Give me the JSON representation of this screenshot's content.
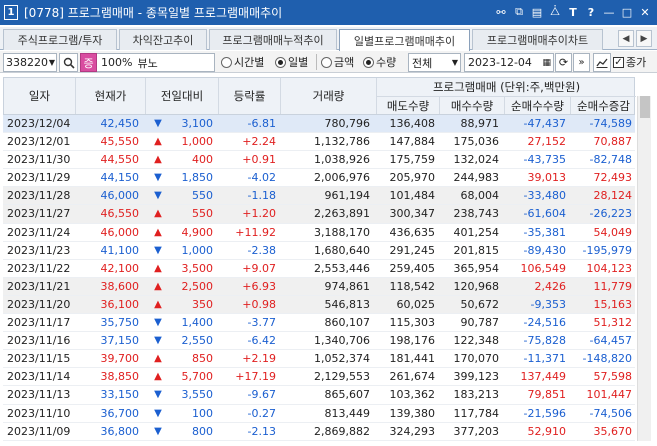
{
  "window": {
    "number": "1",
    "title": "[0778] 프로그램매매 - 종목일별 프로그램매매추이",
    "icons": [
      "link-icon",
      "copy-icon",
      "window-icon",
      "pin-icon",
      "text-icon",
      "help-icon",
      "minimize-icon",
      "maximize-icon",
      "close-icon"
    ]
  },
  "tabs": [
    {
      "label": "주식프로그램/투자"
    },
    {
      "label": "차익잔고추이"
    },
    {
      "label": "프로그램매매누적추이"
    },
    {
      "label": "일별프로그램매매추이",
      "active": true
    },
    {
      "label": "프로그램매매추이차트"
    }
  ],
  "toolbar": {
    "code": "338220",
    "badge": "증",
    "ratio": "100%",
    "stock_name": "뷰노",
    "radio_time": "시간별",
    "radio_daily": "일별",
    "radio_amount": "금액",
    "radio_qty": "수량",
    "market_select": "전체",
    "date": "2023-12-04",
    "checkbox_label": "종가"
  },
  "header": {
    "date": "일자",
    "price": "현재가",
    "change": "전일대비",
    "rate": "등락률",
    "volume": "거래량",
    "program_group": "프로그램매매 (단위:주,백만원)",
    "sell": "매도수량",
    "buy": "매수수량",
    "net": "순매수수량",
    "net_change": "순매수증감"
  },
  "rows": [
    {
      "date": "2023/12/04",
      "price": "42,450",
      "dir": "dn",
      "change": "3,100",
      "rate": "-6.81",
      "volume": "780,796",
      "sell": "136,408",
      "buy": "88,971",
      "net": "-47,437",
      "net_change": "-74,589"
    },
    {
      "date": "2023/12/01",
      "price": "45,550",
      "dir": "up",
      "change": "1,000",
      "rate": "+2.24",
      "volume": "1,132,786",
      "sell": "147,884",
      "buy": "175,036",
      "net": "27,152",
      "net_change": "70,887"
    },
    {
      "date": "2023/11/30",
      "price": "44,550",
      "dir": "up",
      "change": "400",
      "rate": "+0.91",
      "volume": "1,038,926",
      "sell": "175,759",
      "buy": "132,024",
      "net": "-43,735",
      "net_change": "-82,748"
    },
    {
      "date": "2023/11/29",
      "price": "44,150",
      "dir": "dn",
      "change": "1,850",
      "rate": "-4.02",
      "volume": "2,006,976",
      "sell": "205,970",
      "buy": "244,983",
      "net": "39,013",
      "net_change": "72,493"
    },
    {
      "date": "2023/11/28",
      "price": "46,000",
      "dir": "dn",
      "change": "550",
      "rate": "-1.18",
      "volume": "961,194",
      "sell": "101,484",
      "buy": "68,004",
      "net": "-33,480",
      "net_change": "28,124"
    },
    {
      "date": "2023/11/27",
      "price": "46,550",
      "dir": "up",
      "change": "550",
      "rate": "+1.20",
      "volume": "2,263,891",
      "sell": "300,347",
      "buy": "238,743",
      "net": "-61,604",
      "net_change": "-26,223"
    },
    {
      "date": "2023/11/24",
      "price": "46,000",
      "dir": "up",
      "change": "4,900",
      "rate": "+11.92",
      "volume": "3,188,170",
      "sell": "436,635",
      "buy": "401,254",
      "net": "-35,381",
      "net_change": "54,049"
    },
    {
      "date": "2023/11/23",
      "price": "41,100",
      "dir": "dn",
      "change": "1,000",
      "rate": "-2.38",
      "volume": "1,680,640",
      "sell": "291,245",
      "buy": "201,815",
      "net": "-89,430",
      "net_change": "-195,979"
    },
    {
      "date": "2023/11/22",
      "price": "42,100",
      "dir": "up",
      "change": "3,500",
      "rate": "+9.07",
      "volume": "2,553,446",
      "sell": "259,405",
      "buy": "365,954",
      "net": "106,549",
      "net_change": "104,123"
    },
    {
      "date": "2023/11/21",
      "price": "38,600",
      "dir": "up",
      "change": "2,500",
      "rate": "+6.93",
      "volume": "974,861",
      "sell": "118,542",
      "buy": "120,968",
      "net": "2,426",
      "net_change": "11,779"
    },
    {
      "date": "2023/11/20",
      "price": "36,100",
      "dir": "up",
      "change": "350",
      "rate": "+0.98",
      "volume": "546,813",
      "sell": "60,025",
      "buy": "50,672",
      "net": "-9,353",
      "net_change": "15,163"
    },
    {
      "date": "2023/11/17",
      "price": "35,750",
      "dir": "dn",
      "change": "1,400",
      "rate": "-3.77",
      "volume": "860,107",
      "sell": "115,303",
      "buy": "90,787",
      "net": "-24,516",
      "net_change": "51,312"
    },
    {
      "date": "2023/11/16",
      "price": "37,150",
      "dir": "dn",
      "change": "2,550",
      "rate": "-6.42",
      "volume": "1,340,706",
      "sell": "198,176",
      "buy": "122,348",
      "net": "-75,828",
      "net_change": "-64,457"
    },
    {
      "date": "2023/11/15",
      "price": "39,700",
      "dir": "up",
      "change": "850",
      "rate": "+2.19",
      "volume": "1,052,374",
      "sell": "181,441",
      "buy": "170,070",
      "net": "-11,371",
      "net_change": "-148,820"
    },
    {
      "date": "2023/11/14",
      "price": "38,850",
      "dir": "up",
      "change": "5,700",
      "rate": "+17.19",
      "volume": "2,129,553",
      "sell": "261,674",
      "buy": "399,123",
      "net": "137,449",
      "net_change": "57,598"
    },
    {
      "date": "2023/11/13",
      "price": "33,150",
      "dir": "dn",
      "change": "3,550",
      "rate": "-9.67",
      "volume": "865,607",
      "sell": "103,362",
      "buy": "183,213",
      "net": "79,851",
      "net_change": "101,447"
    },
    {
      "date": "2023/11/10",
      "price": "36,700",
      "dir": "dn",
      "change": "100",
      "rate": "-0.27",
      "volume": "813,449",
      "sell": "139,380",
      "buy": "117,784",
      "net": "-21,596",
      "net_change": "-74,506"
    },
    {
      "date": "2023/11/09",
      "price": "36,800",
      "dir": "dn",
      "change": "800",
      "rate": "-2.13",
      "volume": "2,869,882",
      "sell": "324,293",
      "buy": "377,203",
      "net": "52,910",
      "net_change": "35,670"
    }
  ],
  "colors": {
    "up": "#e02020",
    "down": "#1b5fd0",
    "title_bar": "#1f5fae"
  }
}
